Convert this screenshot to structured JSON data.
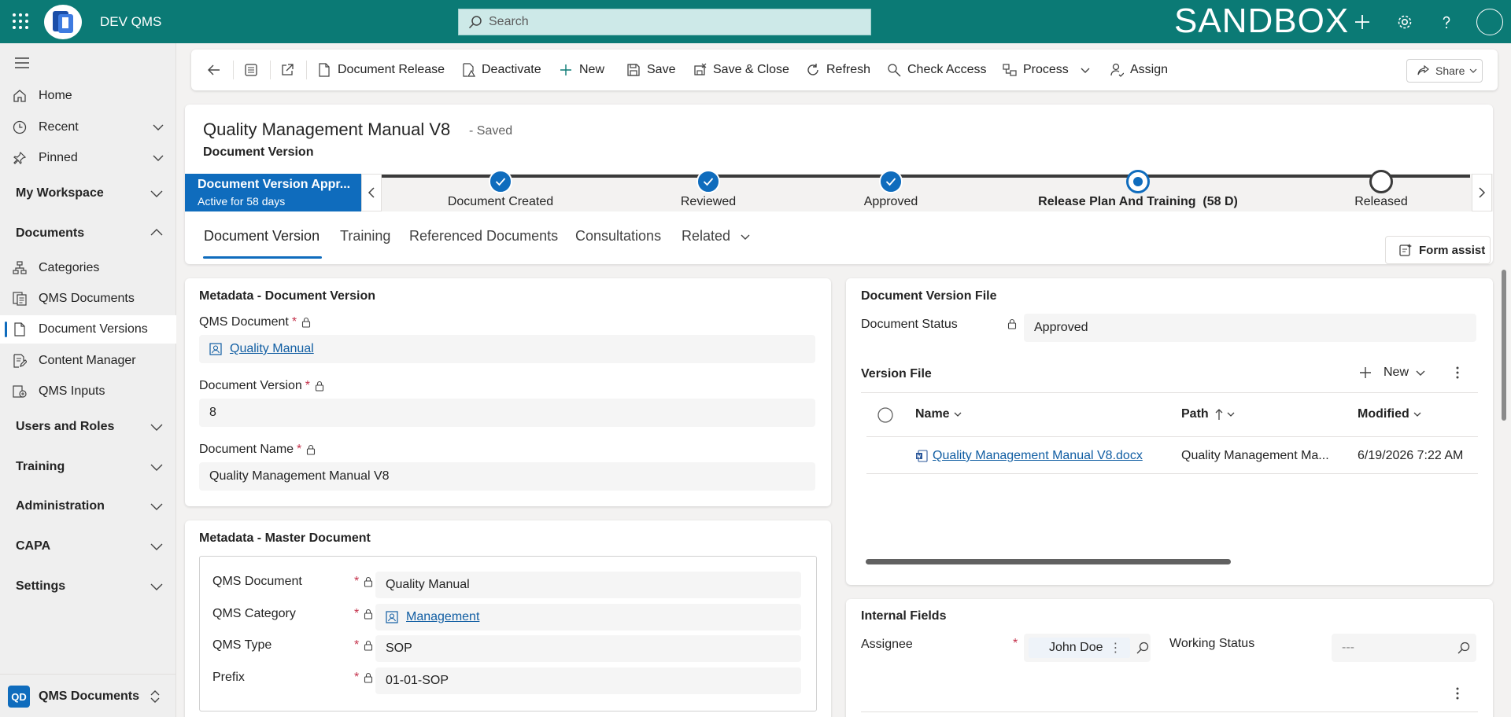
{
  "topbar": {
    "app_name": "DEV QMS",
    "search_placeholder": "Search",
    "environment": "SANDBOX"
  },
  "sidebar": {
    "home": "Home",
    "recent": "Recent",
    "pinned": "Pinned",
    "groups": {
      "my_workspace": "My Workspace",
      "documents": "Documents",
      "users_roles": "Users and Roles",
      "training": "Training",
      "administration": "Administration",
      "capa": "CAPA",
      "settings": "Settings"
    },
    "doc_items": [
      "Categories",
      "QMS Documents",
      "Document Versions",
      "Content Manager",
      "QMS Inputs"
    ],
    "area": {
      "badge": "QD",
      "label": "QMS Documents"
    }
  },
  "commands": {
    "document_release": "Document Release",
    "deactivate": "Deactivate",
    "new": "New",
    "save": "Save",
    "save_close": "Save & Close",
    "refresh": "Refresh",
    "check_access": "Check Access",
    "process": "Process",
    "assign": "Assign",
    "share": "Share"
  },
  "record": {
    "title": "Quality Management Manual V8",
    "saved": "- Saved",
    "entity": "Document Version"
  },
  "bpf": {
    "active_title": "Document Version Appr...",
    "active_sub": "Active for 58 days",
    "stages": [
      "Document Created",
      "Reviewed",
      "Approved",
      "Release Plan And Training  (58 D)",
      "Released"
    ]
  },
  "tabs": [
    "Document Version",
    "Training",
    "Referenced Documents",
    "Consultations",
    "Related"
  ],
  "form_assist": "Form assist",
  "metadata_version": {
    "title": "Metadata - Document Version",
    "qms_document_label": "QMS Document",
    "qms_document_value": "Quality Manual",
    "doc_version_label": "Document Version",
    "doc_version_value": "8",
    "doc_name_label": "Document Name",
    "doc_name_value": "Quality Management Manual V8"
  },
  "metadata_master": {
    "title": "Metadata - Master Document",
    "rows": [
      {
        "label": "QMS Document",
        "value": "Quality Manual"
      },
      {
        "label": "QMS Category",
        "value": "Management"
      },
      {
        "label": "QMS Type",
        "value": "SOP"
      },
      {
        "label": "Prefix",
        "value": "01-01-SOP"
      }
    ]
  },
  "version_file": {
    "card_title": "Document Version File",
    "status_label": "Document Status",
    "status_value": "Approved",
    "subgrid_title": "Version File",
    "new_label": "New",
    "columns": [
      "Name",
      "Path",
      "Modified"
    ],
    "row": {
      "name": "Quality Management Manual V8.docx",
      "path": "Quality Management Ma...",
      "modified": "6/19/2026 7:22 AM"
    }
  },
  "internal_fields": {
    "title": "Internal Fields",
    "assignee_label": "Assignee",
    "assignee_value": "John Doe",
    "working_status_label": "Working Status",
    "working_status_value": "---"
  },
  "colors": {
    "topbar": "#0b7a75",
    "accent": "#0f6cbd",
    "link": "#115ea3"
  }
}
